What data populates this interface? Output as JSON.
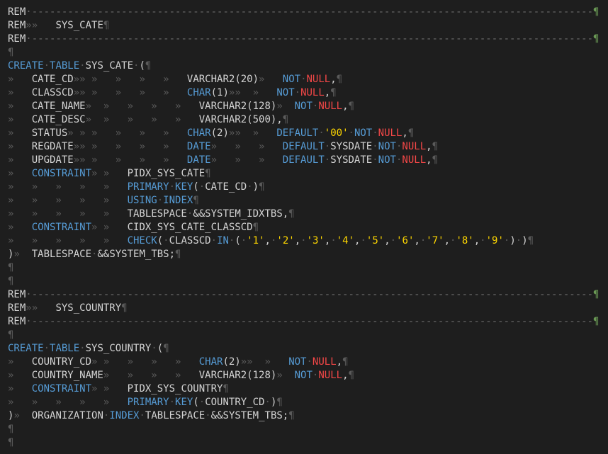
{
  "editor": {
    "colors": {
      "background": "#1e1e1e",
      "keyword": "#569cd6",
      "null": "#f44747",
      "string": "#ffd700",
      "whitespace": "#5a5a5a",
      "rem_marker_pilcrow": "#6a9955"
    },
    "lines": [
      [
        {
          "t": "REM",
          "c": "def"
        },
        {
          "t": "·----------------------------------------------------------------------------------------------",
          "c": "dash"
        },
        {
          "t": "¶",
          "c": "pil"
        }
      ],
      [
        {
          "t": "REM",
          "c": "def"
        },
        {
          "t": "»»",
          "c": "ws"
        },
        {
          "t": "   SYS_CATE",
          "c": "def"
        },
        {
          "t": "¶",
          "c": "ws"
        }
      ],
      [
        {
          "t": "REM",
          "c": "def"
        },
        {
          "t": "·----------------------------------------------------------------------------------------------",
          "c": "dash"
        },
        {
          "t": "¶",
          "c": "pil"
        }
      ],
      [
        {
          "t": "¶",
          "c": "ws"
        }
      ],
      [
        {
          "t": "CREATE",
          "c": "kw"
        },
        {
          "t": "·",
          "c": "ws"
        },
        {
          "t": "TABLE",
          "c": "kw"
        },
        {
          "t": "·",
          "c": "ws"
        },
        {
          "t": "SYS_CATE",
          "c": "def"
        },
        {
          "t": "·",
          "c": "ws"
        },
        {
          "t": "(",
          "c": "def"
        },
        {
          "t": "¶",
          "c": "ws"
        }
      ],
      [
        {
          "t": "»   ",
          "c": "ws"
        },
        {
          "t": "CATE_CD",
          "c": "def"
        },
        {
          "t": "»» »   »   »   »   ",
          "c": "ws"
        },
        {
          "t": "VARCHAR2(20)",
          "c": "ty"
        },
        {
          "t": "»   ",
          "c": "ws"
        },
        {
          "t": "NOT",
          "c": "kw"
        },
        {
          "t": "·",
          "c": "ws"
        },
        {
          "t": "NULL",
          "c": "null"
        },
        {
          "t": ",",
          "c": "def"
        },
        {
          "t": "¶",
          "c": "ws"
        }
      ],
      [
        {
          "t": "»   ",
          "c": "ws"
        },
        {
          "t": "CLASSCD",
          "c": "def"
        },
        {
          "t": "»» »   »   »   »   ",
          "c": "ws"
        },
        {
          "t": "CHAR",
          "c": "kw"
        },
        {
          "t": "(1)",
          "c": "def"
        },
        {
          "t": "»»  »   ",
          "c": "ws"
        },
        {
          "t": "NOT",
          "c": "kw"
        },
        {
          "t": "·",
          "c": "ws"
        },
        {
          "t": "NULL",
          "c": "null"
        },
        {
          "t": ",",
          "c": "def"
        },
        {
          "t": "¶",
          "c": "ws"
        }
      ],
      [
        {
          "t": "»   ",
          "c": "ws"
        },
        {
          "t": "CATE_NAME",
          "c": "def"
        },
        {
          "t": "»  »   »   »   »   ",
          "c": "ws"
        },
        {
          "t": "VARCHAR2(128)",
          "c": "ty"
        },
        {
          "t": "»  ",
          "c": "ws"
        },
        {
          "t": "NOT",
          "c": "kw"
        },
        {
          "t": "·",
          "c": "ws"
        },
        {
          "t": "NULL",
          "c": "null"
        },
        {
          "t": ",",
          "c": "def"
        },
        {
          "t": "¶",
          "c": "ws"
        }
      ],
      [
        {
          "t": "»   ",
          "c": "ws"
        },
        {
          "t": "CATE_DESC",
          "c": "def"
        },
        {
          "t": "»  »   »   »   »   ",
          "c": "ws"
        },
        {
          "t": "VARCHAR2(500),",
          "c": "ty"
        },
        {
          "t": "¶",
          "c": "ws"
        }
      ],
      [
        {
          "t": "»   ",
          "c": "ws"
        },
        {
          "t": "STATUS",
          "c": "def"
        },
        {
          "t": "» » »   »   »   »   ",
          "c": "ws"
        },
        {
          "t": "CHAR",
          "c": "kw"
        },
        {
          "t": "(2)",
          "c": "def"
        },
        {
          "t": "»»  »   ",
          "c": "ws"
        },
        {
          "t": "DEFAULT",
          "c": "kw"
        },
        {
          "t": "·",
          "c": "ws"
        },
        {
          "t": "'00'",
          "c": "str"
        },
        {
          "t": "·",
          "c": "ws"
        },
        {
          "t": "NOT",
          "c": "kw"
        },
        {
          "t": "·",
          "c": "ws"
        },
        {
          "t": "NULL",
          "c": "null"
        },
        {
          "t": ",",
          "c": "def"
        },
        {
          "t": "¶",
          "c": "ws"
        }
      ],
      [
        {
          "t": "»   ",
          "c": "ws"
        },
        {
          "t": "REGDATE",
          "c": "def"
        },
        {
          "t": "»» »   »   »   »   ",
          "c": "ws"
        },
        {
          "t": "DATE",
          "c": "kw"
        },
        {
          "t": "»   »   »   ",
          "c": "ws"
        },
        {
          "t": "DEFAULT",
          "c": "kw"
        },
        {
          "t": "·",
          "c": "ws"
        },
        {
          "t": "SYSDATE",
          "c": "def"
        },
        {
          "t": "·",
          "c": "ws"
        },
        {
          "t": "NOT",
          "c": "kw"
        },
        {
          "t": "·",
          "c": "ws"
        },
        {
          "t": "NULL",
          "c": "null"
        },
        {
          "t": ",",
          "c": "def"
        },
        {
          "t": "¶",
          "c": "ws"
        }
      ],
      [
        {
          "t": "»   ",
          "c": "ws"
        },
        {
          "t": "UPGDATE",
          "c": "def"
        },
        {
          "t": "»» »   »   »   »   ",
          "c": "ws"
        },
        {
          "t": "DATE",
          "c": "kw"
        },
        {
          "t": "»   »   »   ",
          "c": "ws"
        },
        {
          "t": "DEFAULT",
          "c": "kw"
        },
        {
          "t": "·",
          "c": "ws"
        },
        {
          "t": "SYSDATE",
          "c": "def"
        },
        {
          "t": "·",
          "c": "ws"
        },
        {
          "t": "NOT",
          "c": "kw"
        },
        {
          "t": "·",
          "c": "ws"
        },
        {
          "t": "NULL",
          "c": "null"
        },
        {
          "t": ",",
          "c": "def"
        },
        {
          "t": "¶",
          "c": "ws"
        }
      ],
      [
        {
          "t": "»   ",
          "c": "ws"
        },
        {
          "t": "CONSTRAINT",
          "c": "kw"
        },
        {
          "t": "» »   ",
          "c": "ws"
        },
        {
          "t": "PIDX_SYS_CATE",
          "c": "def"
        },
        {
          "t": "¶",
          "c": "ws"
        }
      ],
      [
        {
          "t": "»   »   »   »   »   ",
          "c": "ws"
        },
        {
          "t": "PRIMARY",
          "c": "kw"
        },
        {
          "t": "·",
          "c": "ws"
        },
        {
          "t": "KEY",
          "c": "kw"
        },
        {
          "t": "(",
          "c": "def"
        },
        {
          "t": "·",
          "c": "ws"
        },
        {
          "t": "CATE_CD",
          "c": "def"
        },
        {
          "t": "·",
          "c": "ws"
        },
        {
          "t": ")",
          "c": "def"
        },
        {
          "t": "¶",
          "c": "ws"
        }
      ],
      [
        {
          "t": "»   »   »   »   »   ",
          "c": "ws"
        },
        {
          "t": "USING",
          "c": "kw"
        },
        {
          "t": "·",
          "c": "ws"
        },
        {
          "t": "INDEX",
          "c": "kw"
        },
        {
          "t": "¶",
          "c": "ws"
        }
      ],
      [
        {
          "t": "»   »   »   »   »   ",
          "c": "ws"
        },
        {
          "t": "TABLESPACE",
          "c": "def"
        },
        {
          "t": "·",
          "c": "ws"
        },
        {
          "t": "&&SYSTEM_IDXTBS,",
          "c": "def"
        },
        {
          "t": "¶",
          "c": "ws"
        }
      ],
      [
        {
          "t": "»   ",
          "c": "ws"
        },
        {
          "t": "CONSTRAINT",
          "c": "kw"
        },
        {
          "t": "» »   ",
          "c": "ws"
        },
        {
          "t": "CIDX_SYS_CATE_CLASSCD",
          "c": "def"
        },
        {
          "t": "¶",
          "c": "ws"
        }
      ],
      [
        {
          "t": "»   »   »   »   »   ",
          "c": "ws"
        },
        {
          "t": "CHECK",
          "c": "kw"
        },
        {
          "t": "(",
          "c": "def"
        },
        {
          "t": "·",
          "c": "ws"
        },
        {
          "t": "CLASSCD",
          "c": "def"
        },
        {
          "t": "·",
          "c": "ws"
        },
        {
          "t": "IN",
          "c": "kw"
        },
        {
          "t": "·",
          "c": "ws"
        },
        {
          "t": "(",
          "c": "def"
        },
        {
          "t": "·",
          "c": "ws"
        },
        {
          "t": "'1'",
          "c": "str"
        },
        {
          "t": ",",
          "c": "def"
        },
        {
          "t": "·",
          "c": "ws"
        },
        {
          "t": "'2'",
          "c": "str"
        },
        {
          "t": ",",
          "c": "def"
        },
        {
          "t": "·",
          "c": "ws"
        },
        {
          "t": "'3'",
          "c": "str"
        },
        {
          "t": ",",
          "c": "def"
        },
        {
          "t": "·",
          "c": "ws"
        },
        {
          "t": "'4'",
          "c": "str"
        },
        {
          "t": ",",
          "c": "def"
        },
        {
          "t": "·",
          "c": "ws"
        },
        {
          "t": "'5'",
          "c": "str"
        },
        {
          "t": ",",
          "c": "def"
        },
        {
          "t": "·",
          "c": "ws"
        },
        {
          "t": "'6'",
          "c": "str"
        },
        {
          "t": ",",
          "c": "def"
        },
        {
          "t": "·",
          "c": "ws"
        },
        {
          "t": "'7'",
          "c": "str"
        },
        {
          "t": ",",
          "c": "def"
        },
        {
          "t": "·",
          "c": "ws"
        },
        {
          "t": "'8'",
          "c": "str"
        },
        {
          "t": ",",
          "c": "def"
        },
        {
          "t": "·",
          "c": "ws"
        },
        {
          "t": "'9'",
          "c": "str"
        },
        {
          "t": "·",
          "c": "ws"
        },
        {
          "t": ")",
          "c": "def"
        },
        {
          "t": "·",
          "c": "ws"
        },
        {
          "t": ")",
          "c": "def"
        },
        {
          "t": "¶",
          "c": "ws"
        }
      ],
      [
        {
          "t": ")",
          "c": "def"
        },
        {
          "t": "»  ",
          "c": "ws"
        },
        {
          "t": "TABLESPACE",
          "c": "def"
        },
        {
          "t": "·",
          "c": "ws"
        },
        {
          "t": "&&SYSTEM_TBS;",
          "c": "def"
        },
        {
          "t": "¶",
          "c": "ws"
        }
      ],
      [
        {
          "t": "¶",
          "c": "ws"
        }
      ],
      [
        {
          "t": "¶",
          "c": "ws"
        }
      ],
      [
        {
          "t": "REM",
          "c": "def"
        },
        {
          "t": "·----------------------------------------------------------------------------------------------",
          "c": "dash"
        },
        {
          "t": "¶",
          "c": "pil"
        }
      ],
      [
        {
          "t": "REM",
          "c": "def"
        },
        {
          "t": "»»",
          "c": "ws"
        },
        {
          "t": "   SYS_COUNTRY",
          "c": "def"
        },
        {
          "t": "¶",
          "c": "ws"
        }
      ],
      [
        {
          "t": "REM",
          "c": "def"
        },
        {
          "t": "·----------------------------------------------------------------------------------------------",
          "c": "dash"
        },
        {
          "t": "¶",
          "c": "pil"
        }
      ],
      [
        {
          "t": "¶",
          "c": "ws"
        }
      ],
      [
        {
          "t": "CREATE",
          "c": "kw"
        },
        {
          "t": "·",
          "c": "ws"
        },
        {
          "t": "TABLE",
          "c": "kw"
        },
        {
          "t": "·",
          "c": "ws"
        },
        {
          "t": "SYS_COUNTRY",
          "c": "def"
        },
        {
          "t": "·",
          "c": "ws"
        },
        {
          "t": "(",
          "c": "def"
        },
        {
          "t": "¶",
          "c": "ws"
        }
      ],
      [
        {
          "t": "»   ",
          "c": "ws"
        },
        {
          "t": "COUNTRY_CD",
          "c": "def"
        },
        {
          "t": "» »   »   »   »   ",
          "c": "ws"
        },
        {
          "t": "CHAR",
          "c": "kw"
        },
        {
          "t": "(2)",
          "c": "def"
        },
        {
          "t": "»»  »   ",
          "c": "ws"
        },
        {
          "t": "NOT",
          "c": "kw"
        },
        {
          "t": "·",
          "c": "ws"
        },
        {
          "t": "NULL",
          "c": "null"
        },
        {
          "t": ",",
          "c": "def"
        },
        {
          "t": "¶",
          "c": "ws"
        }
      ],
      [
        {
          "t": "»   ",
          "c": "ws"
        },
        {
          "t": "COUNTRY_NAME",
          "c": "def"
        },
        {
          "t": "»   »   »   »   ",
          "c": "ws"
        },
        {
          "t": "VARCHAR2(128)",
          "c": "ty"
        },
        {
          "t": "»  ",
          "c": "ws"
        },
        {
          "t": "NOT",
          "c": "kw"
        },
        {
          "t": "·",
          "c": "ws"
        },
        {
          "t": "NULL",
          "c": "null"
        },
        {
          "t": ",",
          "c": "def"
        },
        {
          "t": "¶",
          "c": "ws"
        }
      ],
      [
        {
          "t": "»   ",
          "c": "ws"
        },
        {
          "t": "CONSTRAINT",
          "c": "kw"
        },
        {
          "t": "» »   ",
          "c": "ws"
        },
        {
          "t": "PIDX_SYS_COUNTRY",
          "c": "def"
        },
        {
          "t": "¶",
          "c": "ws"
        }
      ],
      [
        {
          "t": "»   »   »   »   »   ",
          "c": "ws"
        },
        {
          "t": "PRIMARY",
          "c": "kw"
        },
        {
          "t": "·",
          "c": "ws"
        },
        {
          "t": "KEY",
          "c": "kw"
        },
        {
          "t": "(",
          "c": "def"
        },
        {
          "t": "·",
          "c": "ws"
        },
        {
          "t": "COUNTRY_CD",
          "c": "def"
        },
        {
          "t": "·",
          "c": "ws"
        },
        {
          "t": ")",
          "c": "def"
        },
        {
          "t": "¶",
          "c": "ws"
        }
      ],
      [
        {
          "t": ")",
          "c": "def"
        },
        {
          "t": "»  ",
          "c": "ws"
        },
        {
          "t": "ORGANIZATION",
          "c": "def"
        },
        {
          "t": "·",
          "c": "ws"
        },
        {
          "t": "INDEX",
          "c": "kw"
        },
        {
          "t": "·",
          "c": "ws"
        },
        {
          "t": "TABLESPACE",
          "c": "def"
        },
        {
          "t": "·",
          "c": "ws"
        },
        {
          "t": "&&SYSTEM_TBS;",
          "c": "def"
        },
        {
          "t": "¶",
          "c": "ws"
        }
      ],
      [
        {
          "t": "¶",
          "c": "ws"
        }
      ],
      [
        {
          "t": "¶",
          "c": "ws"
        }
      ]
    ]
  }
}
